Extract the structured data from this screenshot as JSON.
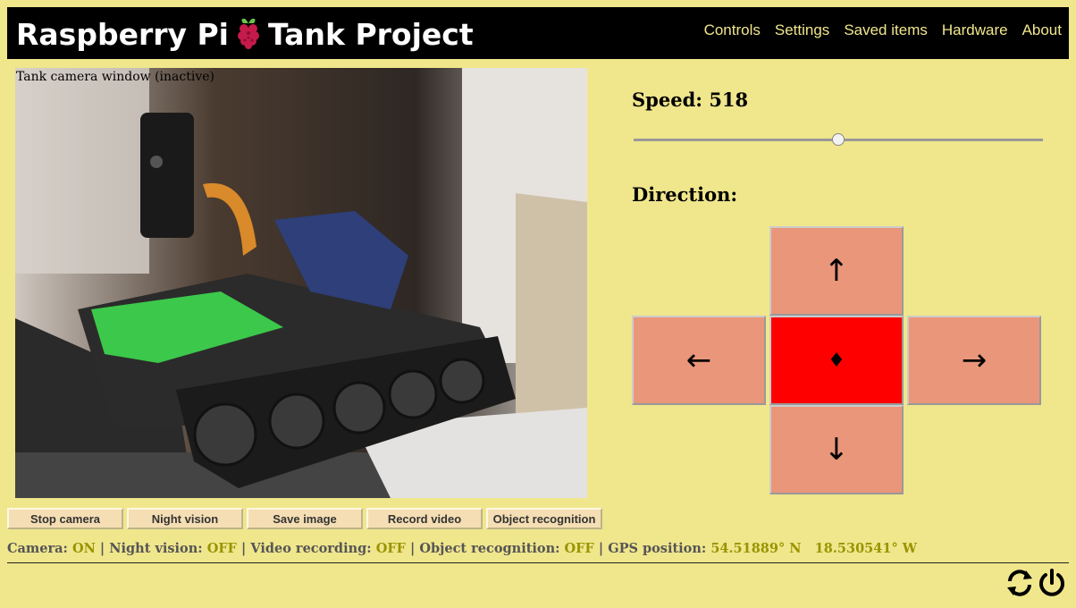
{
  "header": {
    "title_left": "Raspberry Pi",
    "title_right": "Tank Project",
    "logo_icon": "raspberry-icon",
    "nav": [
      "Controls",
      "Settings",
      "Saved items",
      "Hardware",
      "About"
    ]
  },
  "camera": {
    "label": "Tank camera window (inactive)"
  },
  "buttons": [
    "Stop camera",
    "Night vision",
    "Save image",
    "Record video",
    "Object recognition"
  ],
  "status": {
    "camera_label": "Camera:",
    "camera_value": "ON",
    "night_label": "Night vision:",
    "night_value": "OFF",
    "video_label": "Video recording:",
    "video_value": "OFF",
    "object_label": "Object recognition:",
    "object_value": "OFF",
    "gps_label": "GPS position:",
    "gps_value": "54.51889° N   18.530541° W",
    "separator": "|"
  },
  "controls": {
    "speed_label": "Speed: 518",
    "speed_fraction": 0.5,
    "direction_label": "Direction:",
    "up": "↑",
    "down": "↓",
    "left": "←",
    "right": "→",
    "stop": "♦"
  },
  "footer_icons": [
    "refresh-icon",
    "power-icon"
  ],
  "colors": {
    "background": "#f0e68c",
    "header": "#000000",
    "nav_link": "#f0e68c",
    "dpad": "#e9967a",
    "dpad_stop": "#ff0000",
    "button": "#f5deb3",
    "status_value": "#999400"
  }
}
